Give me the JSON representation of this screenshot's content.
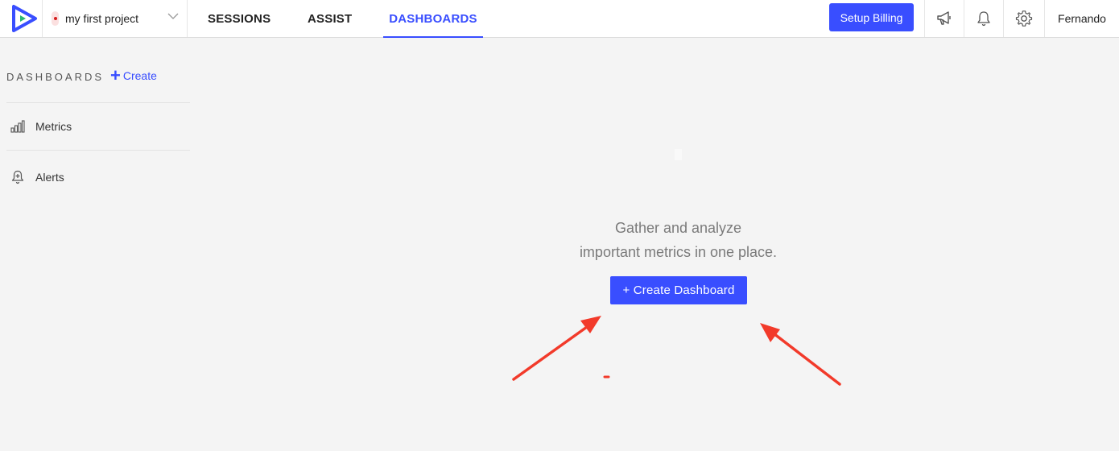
{
  "header": {
    "project": {
      "name": "my first project"
    },
    "nav_tabs": [
      {
        "label": "SESSIONS",
        "active": false
      },
      {
        "label": "ASSIST",
        "active": false
      },
      {
        "label": "DASHBOARDS",
        "active": true
      }
    ],
    "billing_button": "Setup Billing",
    "icons": [
      "megaphone-icon",
      "bell-icon",
      "gear-icon"
    ],
    "user_name": "Fernando"
  },
  "sidebar": {
    "title": "DASHBOARDS",
    "create_label": "Create",
    "items": [
      {
        "label": "Metrics",
        "icon": "bar-chart-icon"
      },
      {
        "label": "Alerts",
        "icon": "bell-plus-icon"
      }
    ]
  },
  "main": {
    "empty_line1": "Gather and analyze",
    "empty_line2": "important metrics in one place.",
    "create_button": "+ Create Dashboard"
  },
  "colors": {
    "accent": "#394eff",
    "background": "#f4f4f4",
    "annotation_arrow": "#f23a2a"
  }
}
